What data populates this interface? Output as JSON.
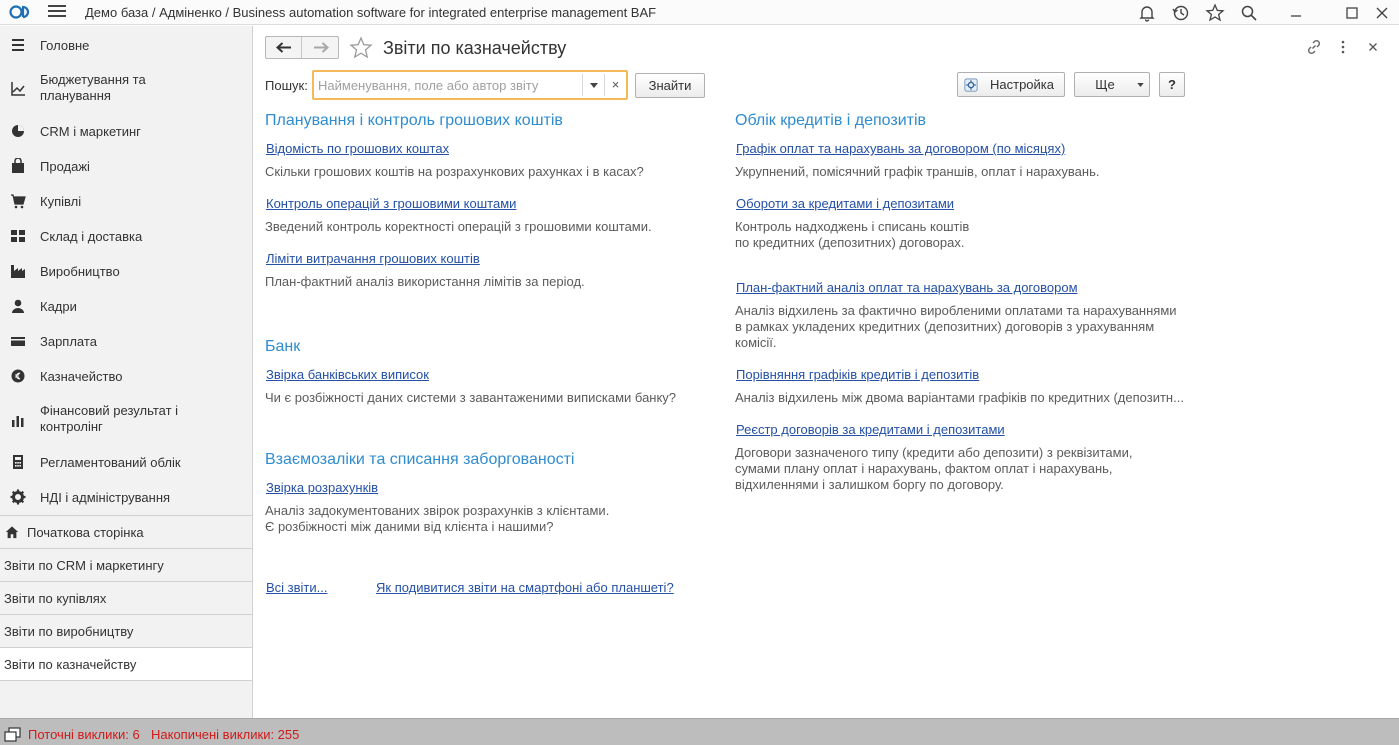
{
  "app": {
    "title": "Демо база / Адміненко / Business automation software for integrated enterprise management BAF"
  },
  "sidebar": {
    "sections": [
      {
        "label": "Головне",
        "icon": "menu-lines-icon"
      },
      {
        "label": "Бюджетування та\nпланування",
        "icon": "chart-line-icon"
      },
      {
        "label": "CRM і маркетинг",
        "icon": "pie-chart-icon"
      },
      {
        "label": "Продажі",
        "icon": "shopping-bag-icon"
      },
      {
        "label": "Купівлі",
        "icon": "cart-icon"
      },
      {
        "label": "Склад і доставка",
        "icon": "warehouse-grid-icon"
      },
      {
        "label": "Виробництво",
        "icon": "factory-icon"
      },
      {
        "label": "Кадри",
        "icon": "person-icon"
      },
      {
        "label": "Зарплата",
        "icon": "wallet-card-icon"
      },
      {
        "label": "Казначейство",
        "icon": "coin-icon"
      },
      {
        "label": "Фінансовий результат і\nконтролінг",
        "icon": "bar-chart-icon"
      },
      {
        "label": "Регламентований облік",
        "icon": "calculator-icon"
      },
      {
        "label": "НДІ і адміністрування",
        "icon": "gear-icon"
      }
    ],
    "open_pages": [
      {
        "label": "Початкова сторінка",
        "icon": "home-icon"
      },
      {
        "label": "Звіти по CRM і маркетингу"
      },
      {
        "label": "Звіти по купівлях"
      },
      {
        "label": "Звіти по виробництву"
      },
      {
        "label": "Звіти по казначейству",
        "active": true
      }
    ]
  },
  "page": {
    "title": "Звіти по казначейству",
    "search": {
      "label": "Пошук:",
      "placeholder": "Найменування, поле або автор звіту",
      "value": "",
      "clear_glyph": "×",
      "find_button": "Знайти"
    },
    "settings_button": "Настройка",
    "more_button": "Ще",
    "help_button": "?"
  },
  "groups_left": [
    {
      "title": "Планування і контроль грошових коштів",
      "reports": [
        {
          "name": "Відомість по грошових коштах",
          "desc": "Скільки грошових коштів на розрахункових рахунках і в касах?"
        },
        {
          "name": "Контроль операцій з грошовими коштами",
          "desc": "Зведений контроль коректності операцій з грошовими коштами."
        },
        {
          "name": "Ліміти витрачання грошових коштів",
          "desc": "План-фактний аналіз використання лімітів за період."
        }
      ]
    },
    {
      "title": "Банк",
      "reports": [
        {
          "name": "Звірка банківських виписок",
          "desc": "Чи є розбіжності даних системи з завантаженими виписками банку?"
        }
      ]
    },
    {
      "title": "Взаємозаліки та списання заборгованості",
      "reports": [
        {
          "name": "Звірка розрахунків",
          "desc": "Аналіз задокументованих звірок розрахунків з клієнтами.\nЄ розбіжності між даними від клієнта і нашими?"
        }
      ]
    }
  ],
  "groups_right": [
    {
      "title": "Облік кредитів і депозитів",
      "reports": [
        {
          "name": "Графік оплат та нарахувань за договором (по місяцях)",
          "desc": "Укрупнений, помісячний графік траншів, оплат і нарахувань."
        },
        {
          "name": "Обороти за кредитами і депозитами",
          "desc": "Контроль надходжень і списань коштів\nпо кредитних (депозитних) договорах."
        },
        {
          "name": "План-фактний аналіз оплат та нарахувань за договором",
          "desc": "Аналіз відхилень за фактично виробленими оплатами та нарахуваннями\nв рамках укладених кредитних (депозитних) договорів з урахуванням\nкомісії."
        },
        {
          "name": "Порівняння графіків кредитів і депозитів",
          "desc": "Аналіз відхилень між двома варіантами графіків по кредитних (депозитн..."
        },
        {
          "name": "Реєстр договорів за кредитами і депозитами",
          "desc": "Договори зазначеного типу (кредити або депозити) з реквізитами,\nсумами плану оплат і нарахувань, фактом оплат і нарахувань,\nвідхиленнями і залишком боргу по договору."
        }
      ]
    }
  ],
  "footer_links": {
    "all_reports": "Всі звіти...",
    "mobile": "Як подивитися звіти на смартфоні або планшеті?"
  },
  "status": {
    "current_calls": "Поточні виклики: 6",
    "accumulated_calls": "Накопичені виклики: 255"
  },
  "colors": {
    "group_title": "#2f8ccf",
    "link": "#2450a6",
    "status_text": "#d21a1a",
    "search_focus": "#f5b95a"
  }
}
